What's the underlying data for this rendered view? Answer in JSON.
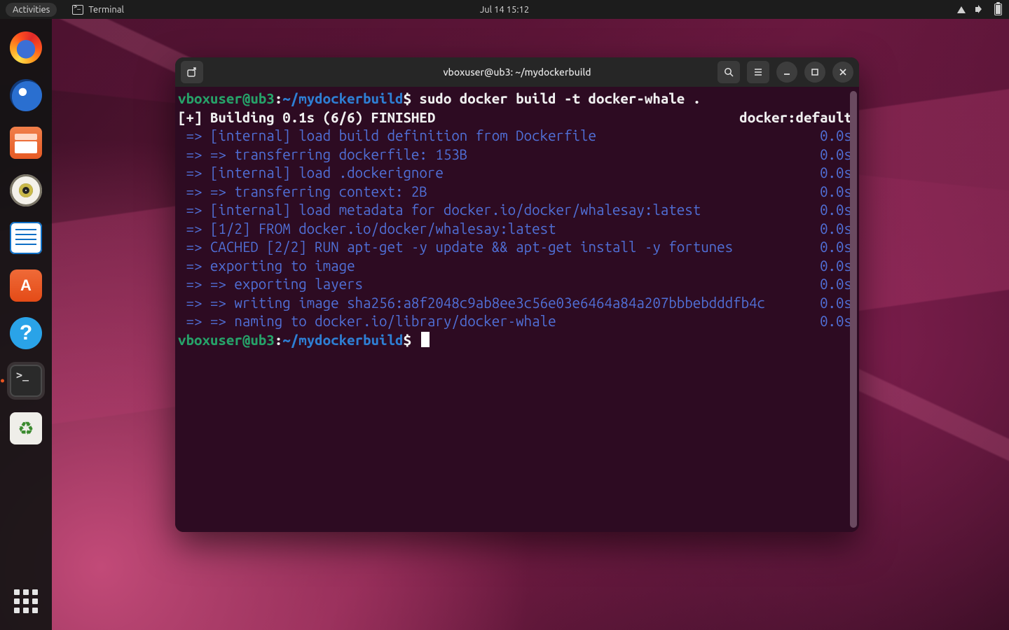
{
  "topbar": {
    "activities": "Activities",
    "app_label": "Terminal",
    "clock": "Jul 14  15:12"
  },
  "dock_items": [
    {
      "name": "firefox",
      "cls": "ico-firefox"
    },
    {
      "name": "thunderbird",
      "cls": "ico-tbird"
    },
    {
      "name": "files",
      "cls": "ico-files"
    },
    {
      "name": "rhythmbox",
      "cls": "ico-rhythm"
    },
    {
      "name": "libreoffice-writer",
      "cls": "ico-writer"
    },
    {
      "name": "ubuntu-software",
      "cls": "ico-software"
    },
    {
      "name": "help",
      "cls": "ico-help"
    },
    {
      "name": "terminal",
      "cls": "ico-term",
      "active": true
    },
    {
      "name": "trash",
      "cls": "ico-trash"
    }
  ],
  "terminal": {
    "title": "vboxuser@ub3: ~/mydockerbuild",
    "prompt": {
      "user_host": "vboxuser@ub3",
      "sep": ":",
      "path": "~/mydockerbuild",
      "sigil": "$"
    },
    "command": "sudo docker build -t docker-whale .",
    "summary_left": "[+] Building 0.1s (6/6) FINISHED",
    "summary_right": "docker:default",
    "steps": [
      {
        "l": " => [internal] load build definition from Dockerfile",
        "r": "0.0s"
      },
      {
        "l": " => => transferring dockerfile: 153B",
        "r": "0.0s"
      },
      {
        "l": " => [internal] load .dockerignore",
        "r": "0.0s"
      },
      {
        "l": " => => transferring context: 2B",
        "r": "0.0s"
      },
      {
        "l": " => [internal] load metadata for docker.io/docker/whalesay:latest",
        "r": "0.0s"
      },
      {
        "l": " => [1/2] FROM docker.io/docker/whalesay:latest",
        "r": "0.0s"
      },
      {
        "l": " => CACHED [2/2] RUN apt-get -y update && apt-get install -y fortunes",
        "r": "0.0s"
      },
      {
        "l": " => exporting to image",
        "r": "0.0s"
      },
      {
        "l": " => => exporting layers",
        "r": "0.0s"
      },
      {
        "l": " => => writing image sha256:a8f2048c9ab8ee3c56e03e6464a84a207bbbebdddfb4c",
        "r": "0.0s"
      },
      {
        "l": " => => naming to docker.io/library/docker-whale",
        "r": "0.0s"
      }
    ]
  }
}
